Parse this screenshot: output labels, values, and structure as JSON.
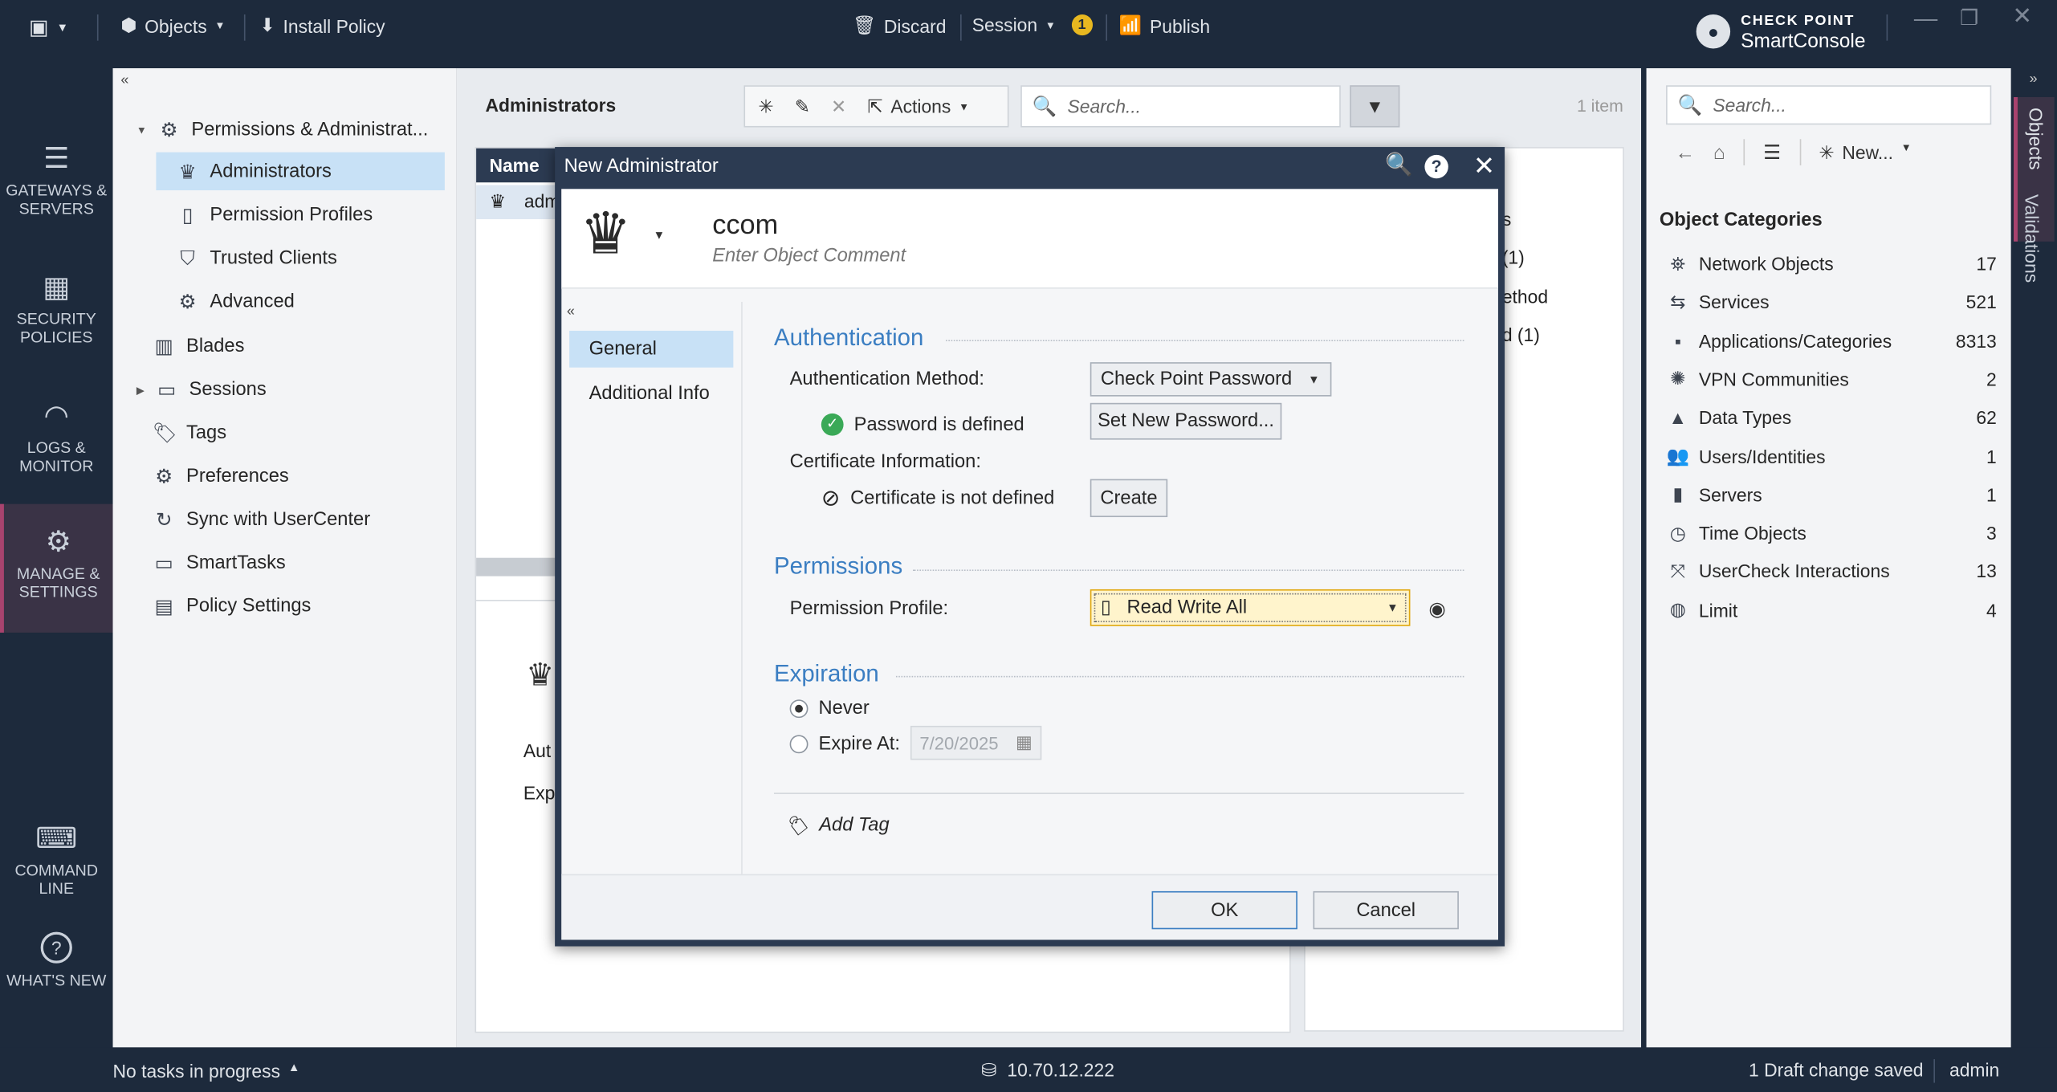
{
  "topbar": {
    "objects_label": "Objects",
    "install_policy_label": "Install Policy",
    "discard_label": "Discard",
    "session_label": "Session",
    "session_badge": "1",
    "publish_label": "Publish",
    "brand_top": "CHECK POINT",
    "brand_bottom": "SmartConsole"
  },
  "leftnav": {
    "gateways": "GATEWAYS & SERVERS",
    "security": "SECURITY POLICIES",
    "logs": "LOGS & MONITOR",
    "manage": "MANAGE & SETTINGS",
    "command": "COMMAND LINE",
    "whatsnew": "WHAT'S NEW"
  },
  "tree": {
    "root": "Permissions & Administrat...",
    "administrators": "Administrators",
    "permission_profiles": "Permission Profiles",
    "trusted_clients": "Trusted Clients",
    "advanced": "Advanced",
    "blades": "Blades",
    "sessions": "Sessions",
    "tags": "Tags",
    "preferences": "Preferences",
    "sync": "Sync with UserCenter",
    "smarttasks": "SmartTasks",
    "policy_settings": "Policy Settings"
  },
  "main": {
    "title": "Administrators",
    "actions_label": "Actions",
    "search_placeholder": "Search...",
    "item_count": "1 item",
    "col_name": "Name",
    "row_admin": "adm",
    "detail_auth": "Aut",
    "detail_exp": "Exp",
    "bg_s": "s",
    "bg_1a": "(1)",
    "bg_ethod": "ethod",
    "bg_d1": "d (1)"
  },
  "right": {
    "search_placeholder": "Search...",
    "new_label": "New...",
    "categories_title": "Object Categories",
    "categories": [
      {
        "icon": "network-icon",
        "name": "Network Objects",
        "count": "17"
      },
      {
        "icon": "services-icon",
        "name": "Services",
        "count": "521"
      },
      {
        "icon": "apps-icon",
        "name": "Applications/Categories",
        "count": "8313"
      },
      {
        "icon": "vpn-icon",
        "name": "VPN Communities",
        "count": "2"
      },
      {
        "icon": "datatypes-icon",
        "name": "Data Types",
        "count": "62"
      },
      {
        "icon": "users-icon",
        "name": "Users/Identities",
        "count": "1"
      },
      {
        "icon": "servers-icon",
        "name": "Servers",
        "count": "1"
      },
      {
        "icon": "time-icon",
        "name": "Time Objects",
        "count": "3"
      },
      {
        "icon": "usercheck-icon",
        "name": "UserCheck Interactions",
        "count": "13"
      },
      {
        "icon": "limit-icon",
        "name": "Limit",
        "count": "4"
      }
    ],
    "tab_objects": "Objects",
    "tab_validations": "Validations"
  },
  "dialog": {
    "title": "New Administrator",
    "name": "ccom",
    "comment_placeholder": "Enter Object Comment",
    "nav_general": "General",
    "nav_additional": "Additional Info",
    "sec_authentication": "Authentication",
    "auth_method_label": "Authentication Method:",
    "auth_method_value": "Check Point Password",
    "password_status": "Password is defined",
    "set_password_button": "Set New Password...",
    "cert_info_label": "Certificate Information:",
    "cert_status": "Certificate is not defined",
    "create_button": "Create",
    "sec_permissions": "Permissions",
    "permission_profile_label": "Permission Profile:",
    "permission_profile_value": "Read Write All",
    "sec_expiration": "Expiration",
    "never_label": "Never",
    "expire_at_label": "Expire At:",
    "expire_date": "7/20/2025",
    "add_tag": "Add Tag",
    "ok_button": "OK",
    "cancel_button": "Cancel"
  },
  "status": {
    "tasks": "No tasks in progress",
    "server_ip": "10.70.12.222",
    "draft": "1 Draft change saved",
    "user": "admin"
  }
}
